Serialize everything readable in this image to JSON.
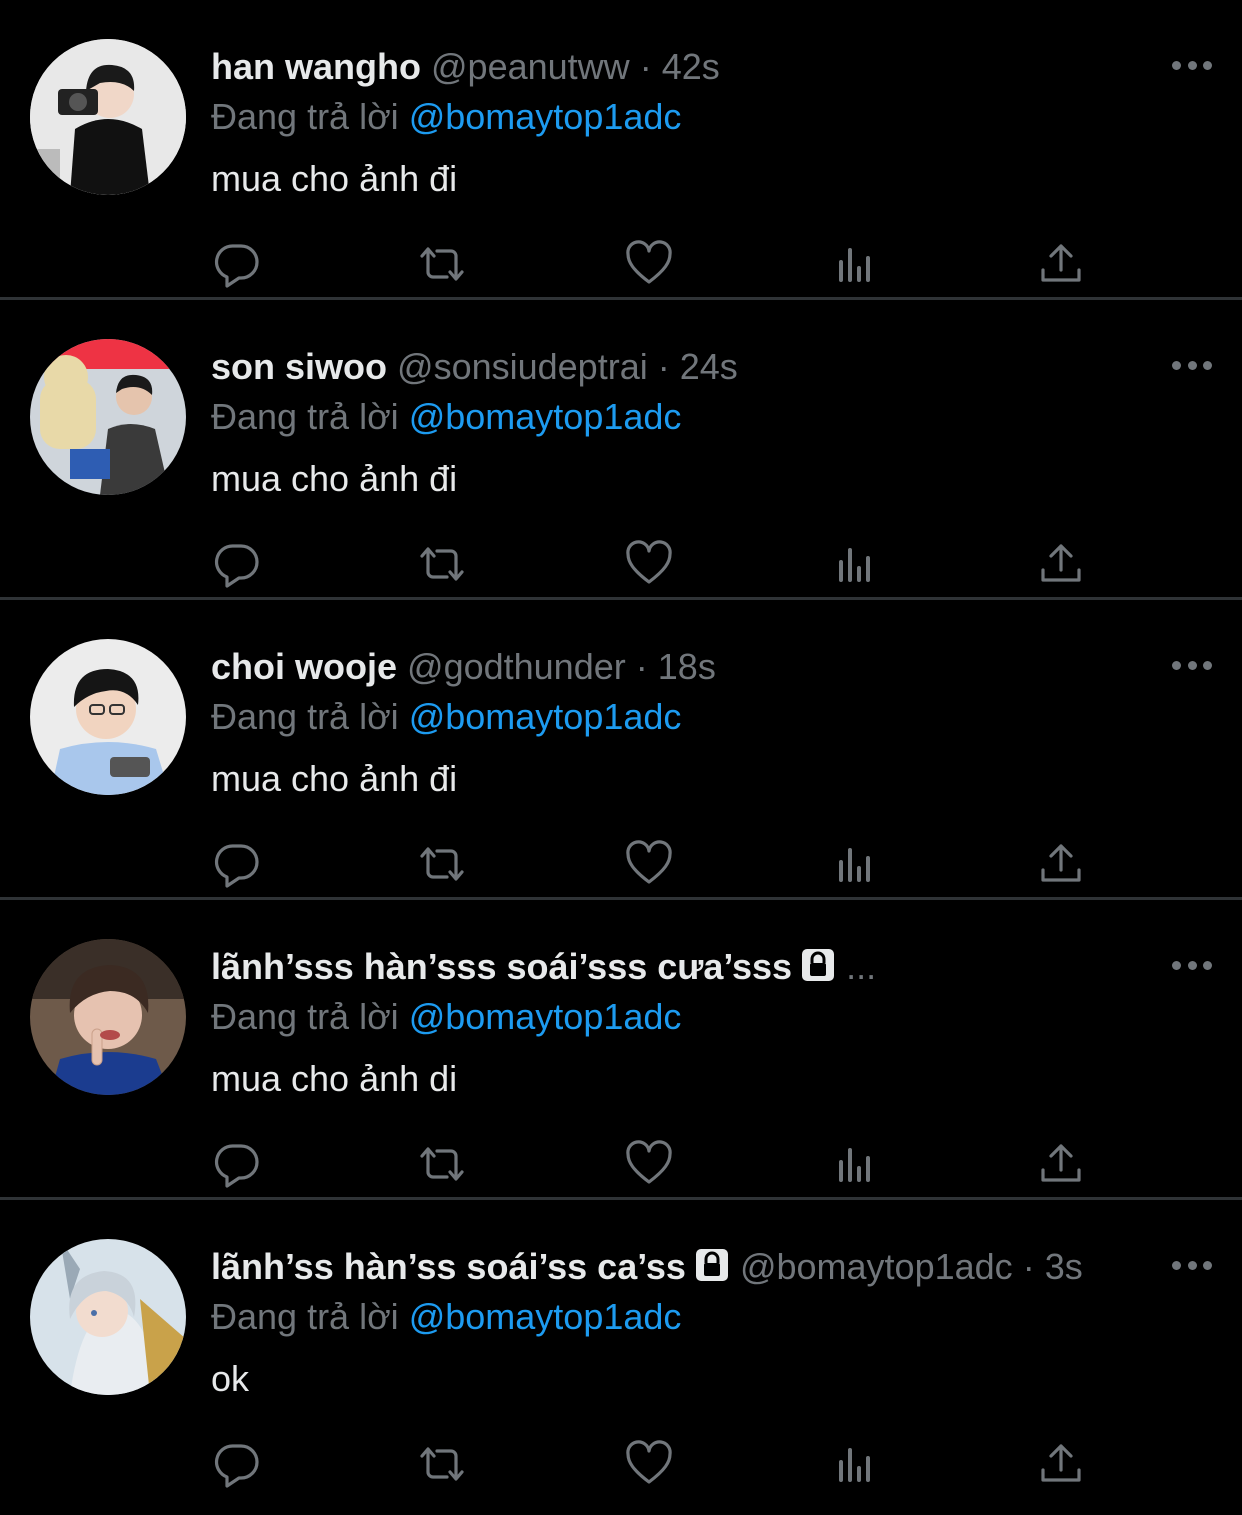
{
  "colors": {
    "background": "#000000",
    "text": "#e7e9ea",
    "muted": "#71767b",
    "link": "#1d9bf0",
    "divider": "#2f3336"
  },
  "tweets": [
    {
      "name": "han wangho",
      "handle": "@peanutww",
      "dot": "·",
      "time": "42s",
      "reply_prefix": "Đang trả lời",
      "reply_target": "@bomaytop1adc",
      "text": "mua cho ảnh đi",
      "locked": false,
      "truncated": false
    },
    {
      "name": "son siwoo",
      "handle": "@sonsiudeptrai",
      "dot": "·",
      "time": "24s",
      "reply_prefix": "Đang trả lời",
      "reply_target": "@bomaytop1adc",
      "text": "mua cho ảnh đi",
      "locked": false,
      "truncated": false
    },
    {
      "name": "choi wooje",
      "handle": "@godthunder",
      "dot": "·",
      "time": "18s",
      "reply_prefix": "Đang trả lời",
      "reply_target": "@bomaytop1adc",
      "text": "mua cho ảnh đi",
      "locked": false,
      "truncated": false
    },
    {
      "name": "lãnh’sss hàn’sss soái’sss cưa’sss",
      "handle": "",
      "dot": "",
      "time": "",
      "ellipsis": "...",
      "reply_prefix": "Đang trả lời",
      "reply_target": "@bomaytop1adc",
      "text": "mua cho ảnh di",
      "locked": true,
      "truncated": true
    },
    {
      "name": "lãnh’ss hàn’ss soái’ss ca’ss",
      "handle": "@bomaytop1adc",
      "dot": "·",
      "time": "3s",
      "reply_prefix": "Đang trả lời",
      "reply_target": "@bomaytop1adc",
      "text": "ok",
      "locked": true,
      "truncated": false
    }
  ],
  "icons": {
    "more": "more-horizontal-icon",
    "reply": "reply-bubble-icon",
    "retweet": "retweet-icon",
    "like": "heart-icon",
    "views": "bar-chart-icon",
    "share": "share-upload-icon",
    "lock": "lock-icon"
  }
}
